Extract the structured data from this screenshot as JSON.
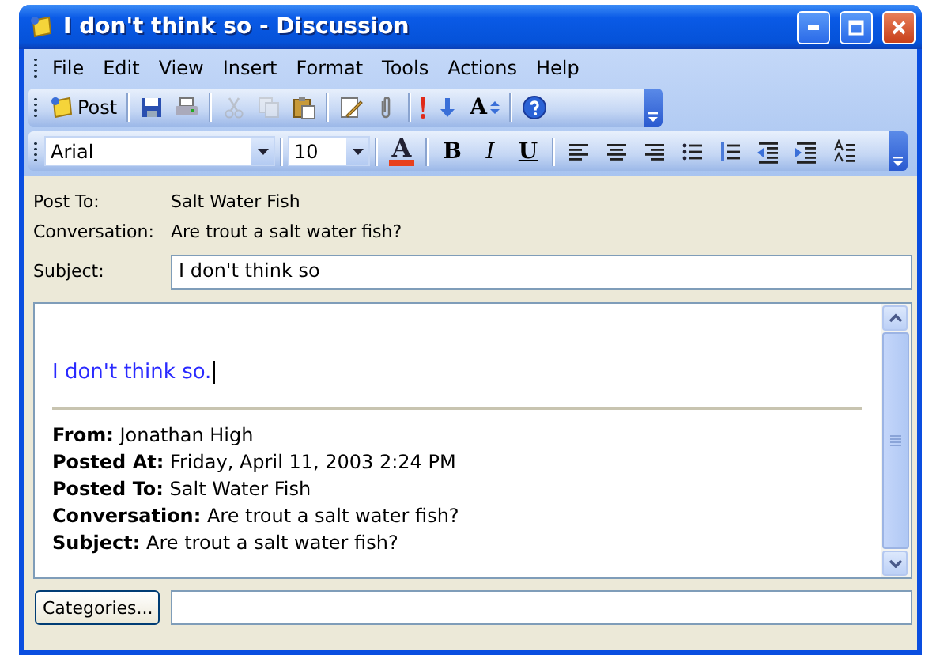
{
  "window": {
    "title": "I don't think so - Discussion"
  },
  "menu": [
    "File",
    "Edit",
    "View",
    "Insert",
    "Format",
    "Tools",
    "Actions",
    "Help"
  ],
  "standard_toolbar": [
    {
      "kind": "post",
      "label": "Post",
      "disabled": false
    },
    {
      "kind": "separator"
    },
    {
      "kind": "save",
      "disabled": false
    },
    {
      "kind": "print",
      "disabled": false
    },
    {
      "kind": "separator"
    },
    {
      "kind": "cut",
      "disabled": true
    },
    {
      "kind": "copy",
      "disabled": true
    },
    {
      "kind": "paste",
      "disabled": false
    },
    {
      "kind": "separator"
    },
    {
      "kind": "edit",
      "disabled": false
    },
    {
      "kind": "attach",
      "disabled": false
    },
    {
      "kind": "separator"
    },
    {
      "kind": "important",
      "disabled": false
    },
    {
      "kind": "low",
      "disabled": false
    },
    {
      "kind": "fontsize",
      "label": "A",
      "disabled": false
    },
    {
      "kind": "separator"
    },
    {
      "kind": "help",
      "disabled": false
    }
  ],
  "format_toolbar": {
    "font": "Arial",
    "size": "10",
    "buttons": [
      {
        "kind": "color",
        "label": "A",
        "color": "#e8401c"
      },
      {
        "kind": "separator"
      },
      {
        "kind": "bold",
        "label": "B"
      },
      {
        "kind": "italic",
        "label": "I"
      },
      {
        "kind": "underline",
        "label": "U"
      },
      {
        "kind": "separator"
      },
      {
        "kind": "align-left"
      },
      {
        "kind": "align-center"
      },
      {
        "kind": "align-right"
      },
      {
        "kind": "bullets"
      },
      {
        "kind": "numbering"
      },
      {
        "kind": "outdent"
      },
      {
        "kind": "indent"
      },
      {
        "kind": "style"
      }
    ]
  },
  "header": [
    {
      "label": "Post To:",
      "value": "Salt Water Fish"
    },
    {
      "label": "Conversation:",
      "value": "Are trout a salt water fish?"
    }
  ],
  "subject": {
    "label": "Subject:",
    "value": "I don't think so"
  },
  "body": {
    "reply": "I don't think so.",
    "quoted": [
      "**From:** Jonathan High",
      "**Posted At:** Friday, April 11, 2003 2:24 PM",
      "**Posted To:** Salt Water Fish",
      "**Conversation:** Are trout a salt water fish?",
      "**Subject:** Are trout a salt water fish?"
    ]
  },
  "categories_button": "Categories..."
}
